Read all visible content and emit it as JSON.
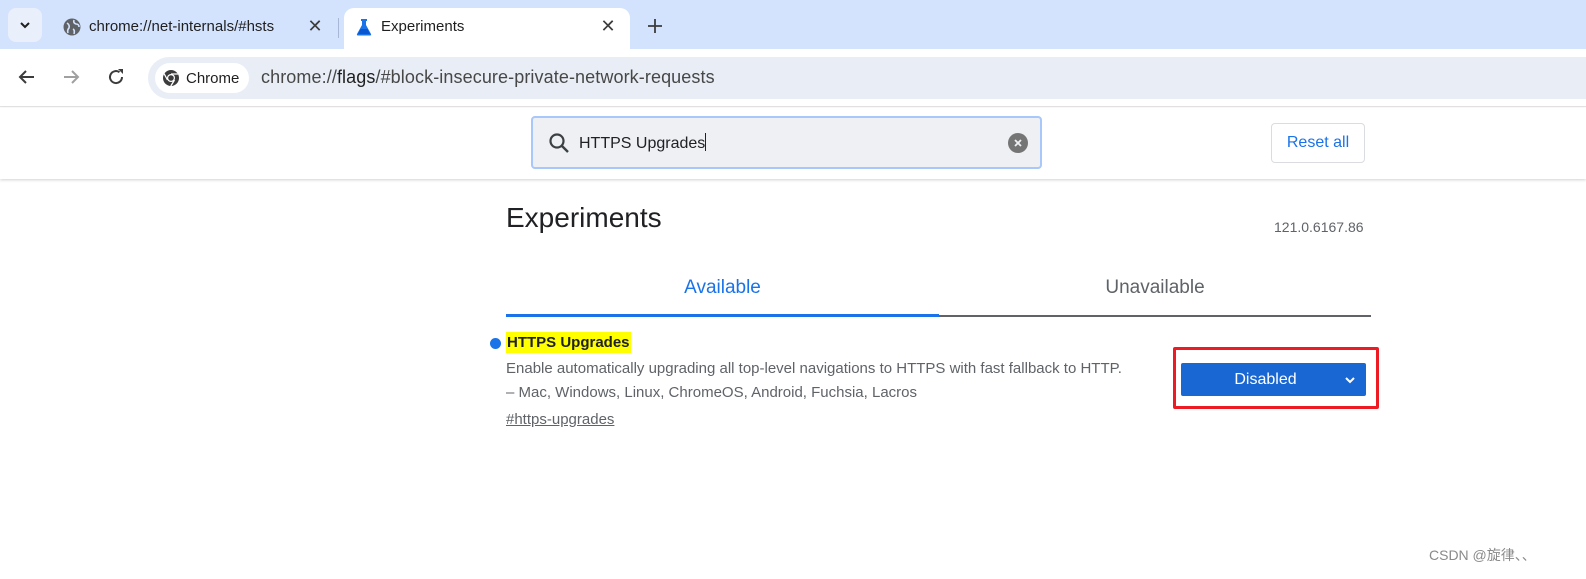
{
  "browser": {
    "tabs": [
      {
        "title": "chrome://net-internals/#hsts",
        "favicon": "globe-icon",
        "active": false
      },
      {
        "title": "Experiments",
        "favicon": "flask-icon",
        "active": true
      }
    ],
    "omnibox": {
      "chip_label": "Chrome",
      "url_scheme": "chrome://",
      "url_host": "flags",
      "url_rest": "/#block-insecure-private-network-requests"
    }
  },
  "header": {
    "search_value": "HTTPS Upgrades",
    "reset_label": "Reset all"
  },
  "page": {
    "title": "Experiments",
    "version": "121.0.6167.86",
    "tabs": [
      {
        "label": "Available",
        "selected": true
      },
      {
        "label": "Unavailable",
        "selected": false
      }
    ]
  },
  "experiment": {
    "name": "HTTPS Upgrades",
    "description": "Enable automatically upgrading all top-level navigations to HTTPS with fast fallback to HTTP.",
    "platforms": "– Mac, Windows, Linux, ChromeOS, Android, Fuchsia, Lacros",
    "permalink": "#https-upgrades",
    "selected_option": "Disabled"
  },
  "watermark": "CSDN @旋律、、",
  "colors": {
    "accent": "#1a73e8",
    "select_bg": "#1967d2",
    "highlight": "#ffff00",
    "annotation_box": "#ed1c24",
    "tabstrip_bg": "#d3e3fd"
  }
}
